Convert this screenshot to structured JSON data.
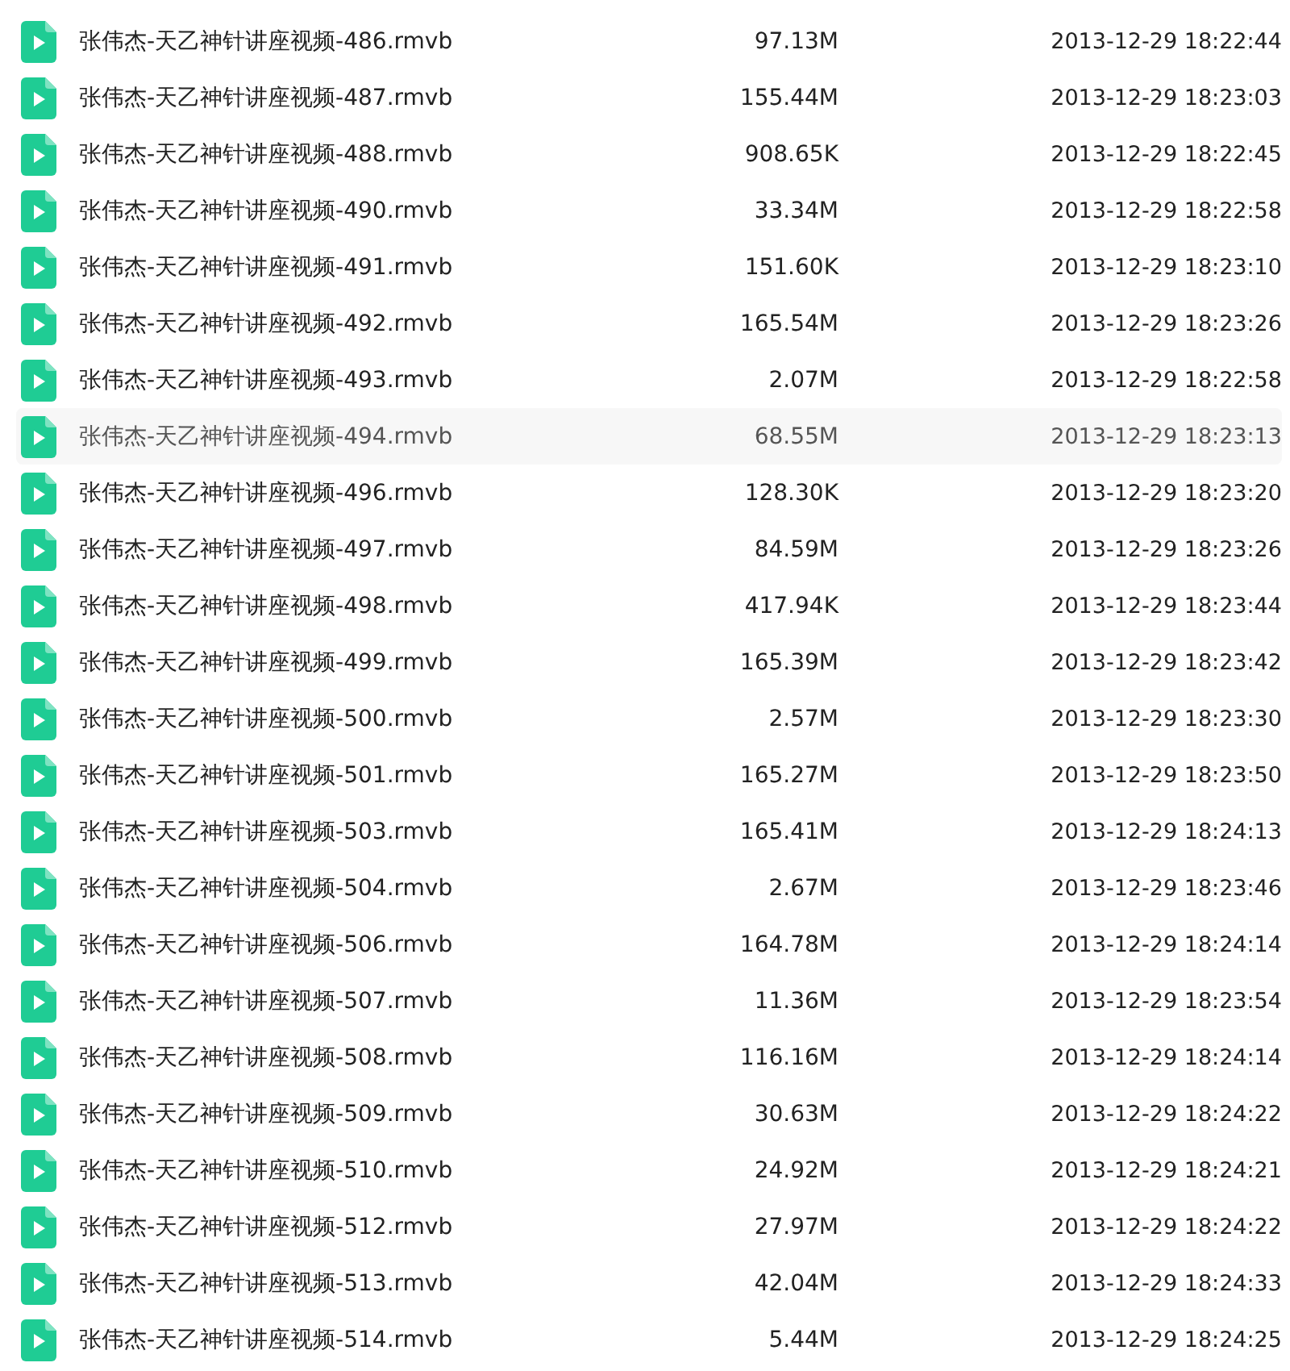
{
  "files": [
    {
      "name": "张伟杰-天乙神针讲座视频-486.rmvb",
      "size": "97.13M",
      "modified": "2013-12-29 18:22:44",
      "selected": false
    },
    {
      "name": "张伟杰-天乙神针讲座视频-487.rmvb",
      "size": "155.44M",
      "modified": "2013-12-29 18:23:03",
      "selected": false
    },
    {
      "name": "张伟杰-天乙神针讲座视频-488.rmvb",
      "size": "908.65K",
      "modified": "2013-12-29 18:22:45",
      "selected": false
    },
    {
      "name": "张伟杰-天乙神针讲座视频-490.rmvb",
      "size": "33.34M",
      "modified": "2013-12-29 18:22:58",
      "selected": false
    },
    {
      "name": "张伟杰-天乙神针讲座视频-491.rmvb",
      "size": "151.60K",
      "modified": "2013-12-29 18:23:10",
      "selected": false
    },
    {
      "name": "张伟杰-天乙神针讲座视频-492.rmvb",
      "size": "165.54M",
      "modified": "2013-12-29 18:23:26",
      "selected": false
    },
    {
      "name": "张伟杰-天乙神针讲座视频-493.rmvb",
      "size": "2.07M",
      "modified": "2013-12-29 18:22:58",
      "selected": false
    },
    {
      "name": "张伟杰-天乙神针讲座视频-494.rmvb",
      "size": "68.55M",
      "modified": "2013-12-29 18:23:13",
      "selected": true
    },
    {
      "name": "张伟杰-天乙神针讲座视频-496.rmvb",
      "size": "128.30K",
      "modified": "2013-12-29 18:23:20",
      "selected": false
    },
    {
      "name": "张伟杰-天乙神针讲座视频-497.rmvb",
      "size": "84.59M",
      "modified": "2013-12-29 18:23:26",
      "selected": false
    },
    {
      "name": "张伟杰-天乙神针讲座视频-498.rmvb",
      "size": "417.94K",
      "modified": "2013-12-29 18:23:44",
      "selected": false
    },
    {
      "name": "张伟杰-天乙神针讲座视频-499.rmvb",
      "size": "165.39M",
      "modified": "2013-12-29 18:23:42",
      "selected": false
    },
    {
      "name": "张伟杰-天乙神针讲座视频-500.rmvb",
      "size": "2.57M",
      "modified": "2013-12-29 18:23:30",
      "selected": false
    },
    {
      "name": "张伟杰-天乙神针讲座视频-501.rmvb",
      "size": "165.27M",
      "modified": "2013-12-29 18:23:50",
      "selected": false
    },
    {
      "name": "张伟杰-天乙神针讲座视频-503.rmvb",
      "size": "165.41M",
      "modified": "2013-12-29 18:24:13",
      "selected": false
    },
    {
      "name": "张伟杰-天乙神针讲座视频-504.rmvb",
      "size": "2.67M",
      "modified": "2013-12-29 18:23:46",
      "selected": false
    },
    {
      "name": "张伟杰-天乙神针讲座视频-506.rmvb",
      "size": "164.78M",
      "modified": "2013-12-29 18:24:14",
      "selected": false
    },
    {
      "name": "张伟杰-天乙神针讲座视频-507.rmvb",
      "size": "11.36M",
      "modified": "2013-12-29 18:23:54",
      "selected": false
    },
    {
      "name": "张伟杰-天乙神针讲座视频-508.rmvb",
      "size": "116.16M",
      "modified": "2013-12-29 18:24:14",
      "selected": false
    },
    {
      "name": "张伟杰-天乙神针讲座视频-509.rmvb",
      "size": "30.63M",
      "modified": "2013-12-29 18:24:22",
      "selected": false
    },
    {
      "name": "张伟杰-天乙神针讲座视频-510.rmvb",
      "size": "24.92M",
      "modified": "2013-12-29 18:24:21",
      "selected": false
    },
    {
      "name": "张伟杰-天乙神针讲座视频-512.rmvb",
      "size": "27.97M",
      "modified": "2013-12-29 18:24:22",
      "selected": false
    },
    {
      "name": "张伟杰-天乙神针讲座视频-513.rmvb",
      "size": "42.04M",
      "modified": "2013-12-29 18:24:33",
      "selected": false
    },
    {
      "name": "张伟杰-天乙神针讲座视频-514.rmvb",
      "size": "5.44M",
      "modified": "2013-12-29 18:24:25",
      "selected": false
    }
  ]
}
